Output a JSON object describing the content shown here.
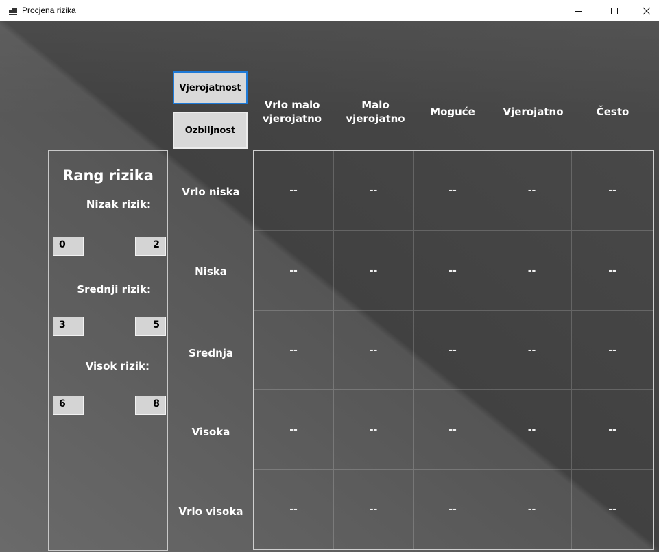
{
  "window": {
    "title": "Procjena rizika",
    "minimize_glyph": "—",
    "maximize_glyph": "☐",
    "close_glyph": "✕"
  },
  "toggle": {
    "probability_label": "Vjerojatnost",
    "severity_label": "Ozbiljnost"
  },
  "columns": [
    "Vrlo malo vjerojatno",
    "Malo vjerojatno",
    "Moguće",
    "Vjerojatno",
    "Često"
  ],
  "rows": [
    "Vrlo niska",
    "Niska",
    "Srednja",
    "Visoka",
    "Vrlo visoka"
  ],
  "cell_value": "--",
  "legend": {
    "title": "Rang rizika",
    "low": {
      "label": "Nizak rizik:",
      "min": "0",
      "max": "2"
    },
    "medium": {
      "label": "Srednji rizik:",
      "min": "3",
      "max": "5"
    },
    "high": {
      "label": "Visok rizik:",
      "min": "6",
      "max": "8"
    }
  }
}
